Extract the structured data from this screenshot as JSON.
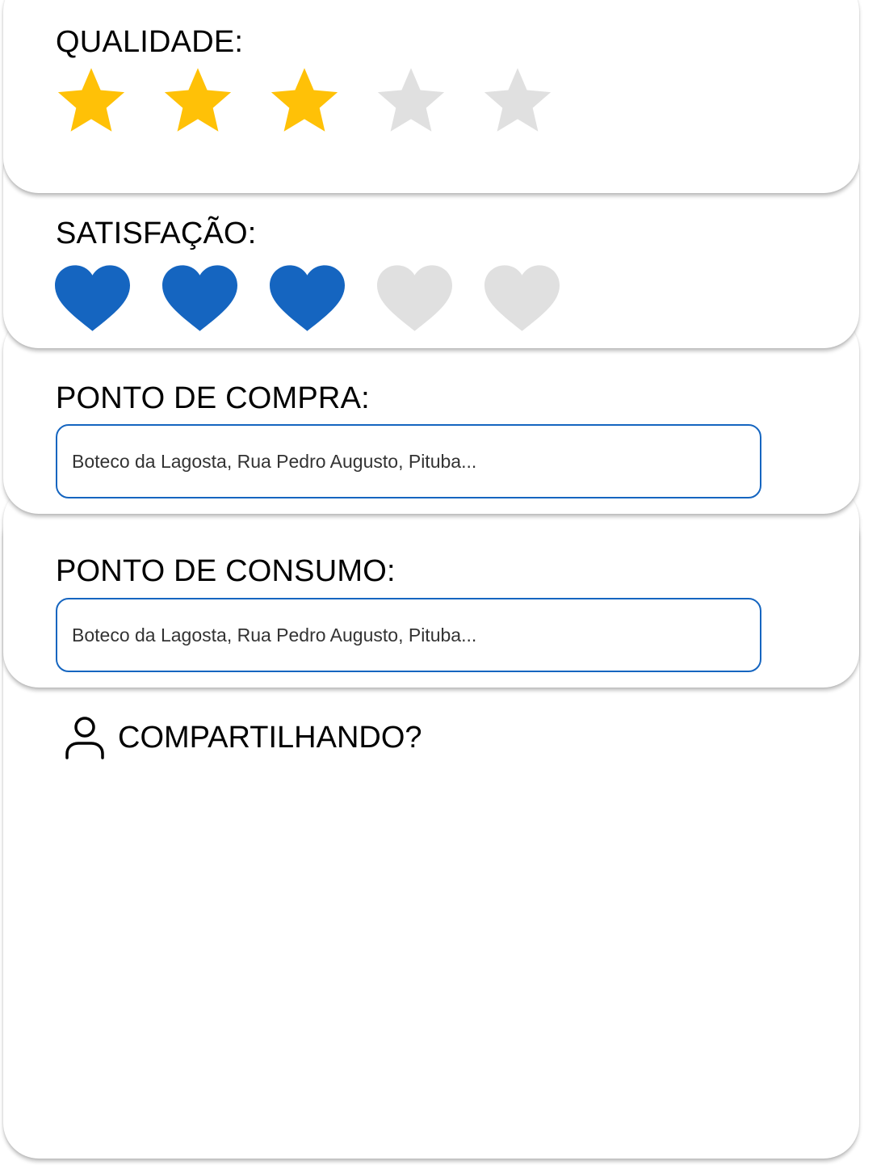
{
  "quality": {
    "title": "QUALIDADE:",
    "max": 5,
    "value": 3,
    "active_color": "#FFC107",
    "inactive_color": "#E0E0E0",
    "icon": "star-icon"
  },
  "satisfaction": {
    "title": "SATISFAÇÃO:",
    "max": 5,
    "value": 3,
    "active_color": "#1565C0",
    "inactive_color": "#E0E0E0",
    "icon": "heart-icon"
  },
  "purchase_point": {
    "title": "PONTO DE COMPRA:",
    "placeholder": "Boteco da Lagosta, Rua Pedro Augusto, Pituba...",
    "value": ""
  },
  "consumption_point": {
    "title": "PONTO DE CONSUMO:",
    "placeholder": "Boteco da Lagosta, Rua Pedro Augusto, Pituba...",
    "value": ""
  },
  "sharing": {
    "label": "COMPARTILHANDO?",
    "icon": "person-icon"
  },
  "colors": {
    "field_border": "#1565C0",
    "text": "#000000",
    "placeholder_text": "#333333"
  }
}
